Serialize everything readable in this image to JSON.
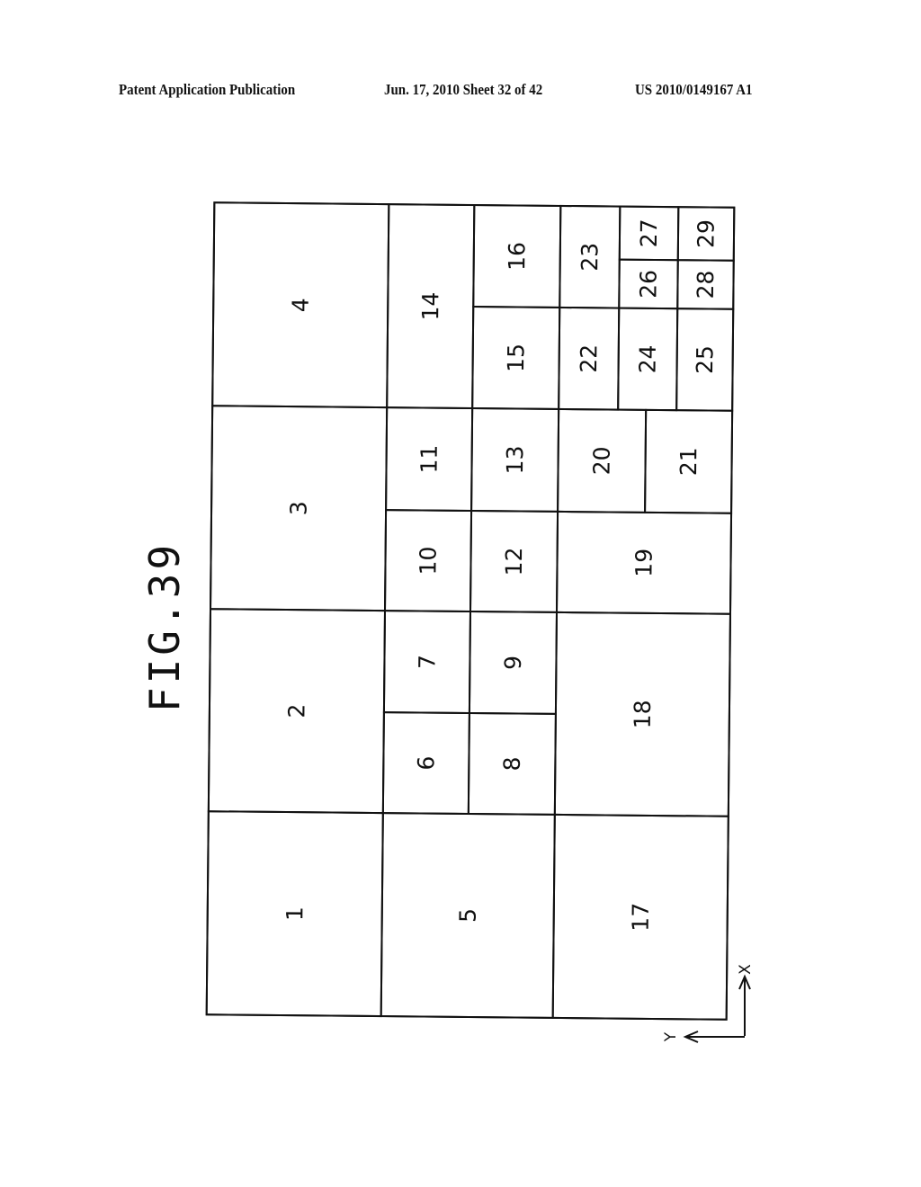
{
  "header": {
    "left": "Patent Application Publication",
    "middle": "Jun. 17, 2010  Sheet 32 of 42",
    "right": "US 2010/0149167 A1"
  },
  "figure": {
    "title": "FIG.39",
    "text_orientation": "rotated 90 degrees counter-clockwise",
    "cells": [
      {
        "id": "1",
        "label": "1"
      },
      {
        "id": "2",
        "label": "2"
      },
      {
        "id": "3",
        "label": "3"
      },
      {
        "id": "4",
        "label": "4"
      },
      {
        "id": "5",
        "label": "5"
      },
      {
        "id": "6",
        "label": "6"
      },
      {
        "id": "7",
        "label": "7"
      },
      {
        "id": "8",
        "label": "8"
      },
      {
        "id": "9",
        "label": "9"
      },
      {
        "id": "10",
        "label": "10"
      },
      {
        "id": "11",
        "label": "11"
      },
      {
        "id": "12",
        "label": "12"
      },
      {
        "id": "13",
        "label": "13"
      },
      {
        "id": "14",
        "label": "14"
      },
      {
        "id": "15",
        "label": "15"
      },
      {
        "id": "16",
        "label": "16"
      },
      {
        "id": "17",
        "label": "17"
      },
      {
        "id": "18",
        "label": "18"
      },
      {
        "id": "19",
        "label": "19"
      },
      {
        "id": "20",
        "label": "20"
      },
      {
        "id": "21",
        "label": "21"
      },
      {
        "id": "22",
        "label": "22"
      },
      {
        "id": "23",
        "label": "23"
      },
      {
        "id": "24",
        "label": "24"
      },
      {
        "id": "25",
        "label": "25"
      },
      {
        "id": "26",
        "label": "26"
      },
      {
        "id": "27",
        "label": "27"
      },
      {
        "id": "28",
        "label": "28"
      },
      {
        "id": "29",
        "label": "29"
      }
    ],
    "axes": {
      "x_label": "X",
      "y_label": "Y"
    }
  }
}
